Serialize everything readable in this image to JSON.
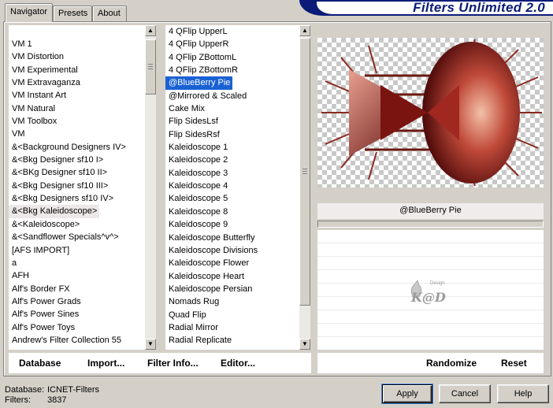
{
  "banner": {
    "title": "Filters Unlimited 2.0",
    "bg_color": "#0a1c78"
  },
  "tabs": [
    {
      "label": "Navigator",
      "active": true
    },
    {
      "label": "Presets",
      "active": false
    },
    {
      "label": "About",
      "active": false
    }
  ],
  "categories": [
    "VM 1",
    "VM Distortion",
    "VM Experimental",
    "VM Extravaganza",
    "VM Instant Art",
    "VM Natural",
    "VM Toolbox",
    "VM",
    "&<Background Designers IV>",
    "&<Bkg Designer sf10 I>",
    "&<BKg Designer sf10 II>",
    "&<Bkg Designer sf10 III>",
    "&<Bkg Designers sf10 IV>",
    "&<Bkg Kaleidoscope>",
    "&<Kaleidoscope>",
    "&<Sandflower Specials^v^>",
    "[AFS IMPORT]",
    "a",
    "AFH",
    "Alf's Border FX",
    "Alf's Power Grads",
    "Alf's Power Sines",
    "Alf's Power Toys",
    "Andrew's Filter Collection 55"
  ],
  "categories_highlight_index": 13,
  "filters": [
    "4 QFlip UpperL",
    "4 QFlip UpperR",
    "4 QFlip ZBottomL",
    "4 QFlip ZBottomR",
    "@BlueBerry Pie",
    "@Mirrored & Scaled",
    "Cake Mix",
    "Flip SidesLsf",
    "Flip SidesRsf",
    "Kaleidoscope 1",
    "Kaleidoscope 2",
    "Kaleidoscope 3",
    "Kaleidoscope 4",
    "Kaleidoscope 5",
    "Kaleidoscope 8",
    "Kaleidoscope 9",
    "Kaleidoscope Butterfly",
    "Kaleidoscope Divisions",
    "Kaleidoscope Flower",
    "Kaleidoscope Heart",
    "Kaleidoscope Persian",
    "Nomads Rug",
    "Quad Flip",
    "Radial Mirror",
    "Radial Replicate"
  ],
  "filters_selected_index": 4,
  "preview": {
    "filter_name": "@BlueBerry Pie",
    "progress": 0
  },
  "logo_text": "K@D",
  "logo_small_text": "Design",
  "left_bar": {
    "database": "Database",
    "import": "Import...",
    "filter_info": "Filter Info...",
    "editor": "Editor..."
  },
  "right_bar": {
    "randomize": "Randomize",
    "reset": "Reset"
  },
  "status": {
    "database_label": "Database:",
    "database_value": "ICNET-Filters",
    "filters_label": "Filters:",
    "filters_value": "3837"
  },
  "buttons": {
    "apply": "Apply",
    "cancel": "Cancel",
    "help": "Help"
  },
  "colors": {
    "selection": "#1a62d4",
    "face": "#d4d0c8",
    "preview_red": "#b0302a"
  }
}
